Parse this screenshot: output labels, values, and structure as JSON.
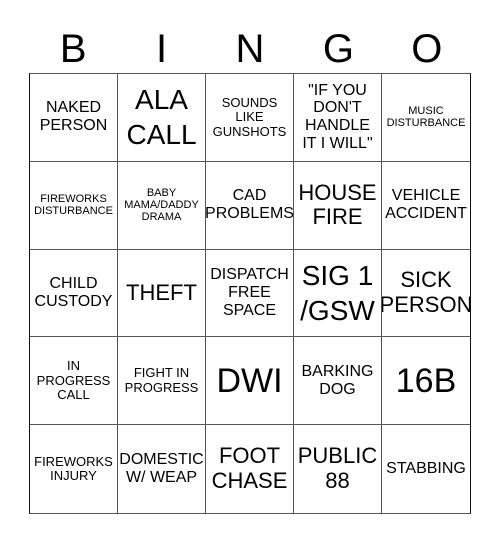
{
  "header": {
    "letters": [
      "B",
      "I",
      "N",
      "G",
      "O"
    ]
  },
  "board": {
    "rows": [
      [
        "NAKED PERSON",
        "ALA CALL",
        "SOUNDS LIKE GUNSHOTS",
        "\"IF YOU DON'T HANDLE IT I WILL\"",
        "MUSIC DISTURBANCE"
      ],
      [
        "FIREWORKS DISTURBANCE",
        "BABY MAMA/DADDY DRAMA",
        "CAD PROBLEMS",
        "HOUSE FIRE",
        "VEHICLE ACCIDENT"
      ],
      [
        "CHILD CUSTODY",
        "THEFT",
        "DISPATCH FREE SPACE",
        "SIG 1 /GSW",
        "SICK PERSON"
      ],
      [
        "IN PROGRESS CALL",
        "FIGHT IN PROGRESS",
        "DWI",
        "BARKING DOG",
        "16B"
      ],
      [
        "FIREWORKS INJURY",
        "DOMESTIC W/ WEAP",
        "FOOT CHASE",
        "PUBLIC 88",
        "STABBING"
      ]
    ]
  }
}
